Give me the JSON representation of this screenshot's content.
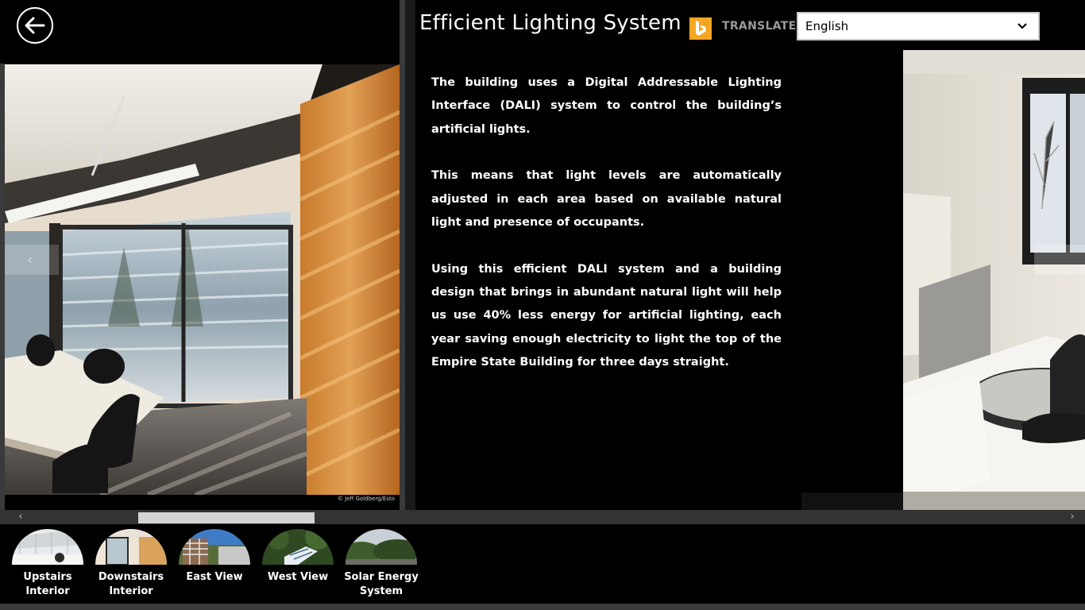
{
  "article": {
    "title": "Efficient Lighting System",
    "paragraphs": [
      "The building uses a Digital Addressable Lighting Interface (DALI) system to control the building’s artificial lights.",
      "This means that light levels are automatically adjusted in each area based on available natural light and presence of occupants.",
      "Using this efficient DALI system and a building design that brings in abundant natural light will help us use 40% less energy for artificial lighting, each year saving enough electricity to light the top of the Empire State Building for three days straight."
    ]
  },
  "translate": {
    "label": "TRANSLATE",
    "language": "English",
    "logo_color": "#f5a623"
  },
  "photo": {
    "credit": "© Jeff Goldberg/Esto"
  },
  "nav": {
    "items": [
      {
        "label_line1": "Upstairs",
        "label_line2": "Interior"
      },
      {
        "label_line1": "Downstairs",
        "label_line2": "Interior"
      },
      {
        "label_line1": "East View",
        "label_line2": ""
      },
      {
        "label_line1": "West View",
        "label_line2": ""
      },
      {
        "label_line1": "Solar Energy",
        "label_line2": "System"
      }
    ]
  },
  "icons": {
    "back": "back-arrow-icon",
    "bing": "bing-logo-icon",
    "chevron": "chevron-down-icon"
  }
}
